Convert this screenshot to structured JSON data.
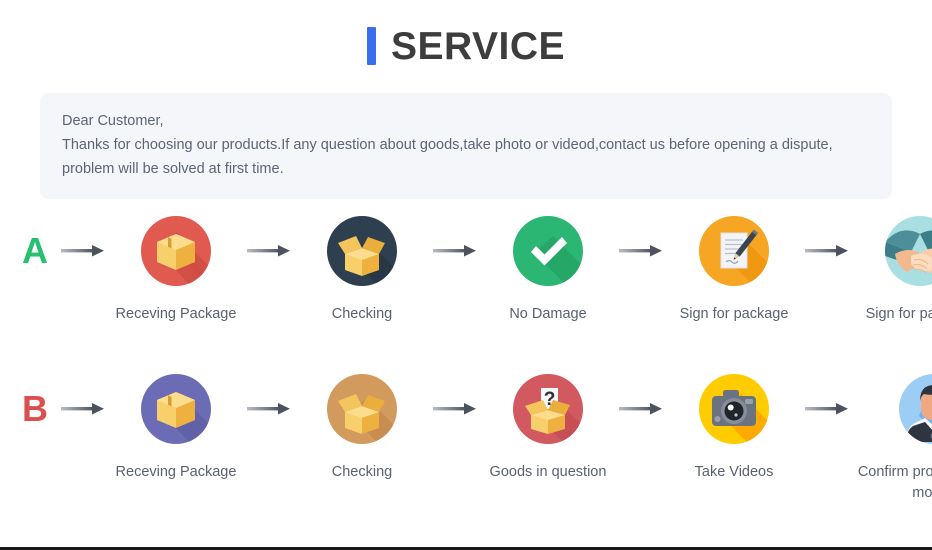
{
  "header": {
    "accent_color": "#3b6eed",
    "title": "SERVICE"
  },
  "notice": {
    "greeting": "Dear Customer,",
    "line2": "Thanks for choosing our products.If any question about goods,take photo or videod,contact us before opening a dispute,",
    "line3": "problem will be solved at first time.",
    "background": "#f5f6fa"
  },
  "flows": [
    {
      "letter": "A",
      "letter_color": "#25c16f",
      "steps": [
        {
          "icon": "closed-box-icon",
          "circle": "#e05a4f",
          "label": "Receving Package"
        },
        {
          "icon": "open-box-icon",
          "circle": "#2e3f4f",
          "label": "Checking"
        },
        {
          "icon": "check-mark-icon",
          "circle": "#2bb673",
          "label": "No Damage"
        },
        {
          "icon": "sign-document-icon",
          "circle": "#f6a623",
          "label": "Sign for package"
        },
        {
          "icon": "handshake-icon",
          "circle": "#a9dfe3",
          "label": "Sign for package"
        }
      ]
    },
    {
      "letter": "B",
      "letter_color": "#d9504f",
      "steps": [
        {
          "icon": "closed-box-icon",
          "circle": "#6b6cb5",
          "label": "Receving Package"
        },
        {
          "icon": "open-box-icon",
          "circle": "#d39a5e",
          "label": "Checking"
        },
        {
          "icon": "question-box-icon",
          "circle": "#d2595f",
          "label": "Goods in question"
        },
        {
          "icon": "camera-icon",
          "circle": "#ffcc00",
          "label": "Take Videos"
        },
        {
          "icon": "person-support-icon",
          "circle": "#9ccdf5",
          "label": "Confirm problem,refund money"
        }
      ]
    }
  ],
  "arrow": {
    "name": "right-arrow-icon",
    "color": "#6b7280"
  }
}
